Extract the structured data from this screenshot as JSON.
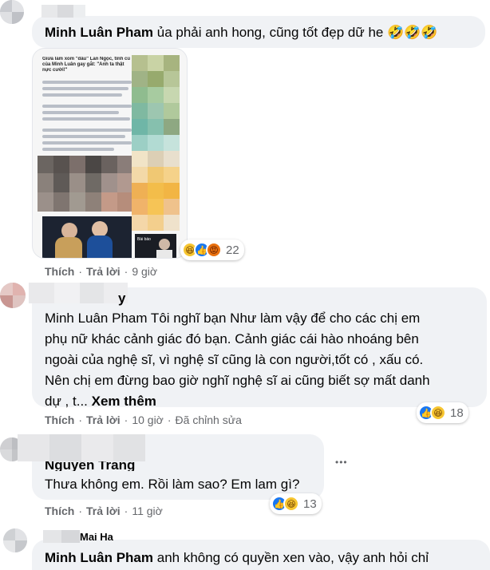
{
  "colors": {
    "bubble": "#f0f2f5",
    "secondary_text": "#65676b",
    "like_blue": "#1877f2",
    "haha_yellow": "#f7c631",
    "angry_orange": "#e9710f"
  },
  "comments": [
    {
      "author": "Minh Luân Pham",
      "text": "ủa phải anh hong, cũng tốt đẹp dữ he 🤣🤣🤣",
      "actions": {
        "like": "Thích",
        "reply": "Trả lời",
        "time": "9 giờ"
      },
      "reactions": {
        "icons": [
          "haha-icon",
          "like-icon",
          "angry-icon"
        ],
        "count": "22"
      },
      "photo": {
        "headline": "Giữa làm xom \"dầu\" Lan Ngọc, tình cũ của Minh Luân gay gắt: \"Anh ta thật nực cười!\"",
        "side_caption": "Bài báo"
      }
    },
    {
      "author_partial": "y",
      "lines": [
        "Minh Luân Pham Tôi nghĩ bạn Như làm vậy để cho các chị em",
        "phụ nữ khác cảnh giác đó bạn. Cảnh giác cái hào nhoáng bên",
        "ngoài của nghệ sĩ, vì nghệ sĩ cũng là con người,tốt có , xấu có.",
        "Nên chị em đừng bao giờ nghĩ nghệ sĩ ai cũng biết sợ mất danh",
        "dự , t..."
      ],
      "see_more": "Xem thêm",
      "actions": {
        "like": "Thích",
        "reply": "Trả lời",
        "time": "10 giờ",
        "edited": "Đã chỉnh sửa"
      },
      "reactions": {
        "icons": [
          "like-icon",
          "haha-icon"
        ],
        "count": "18"
      }
    },
    {
      "author_partial": "Nguyễn Trang",
      "text": "Thưa không em. Rồi làm sao? Em lam gì?",
      "actions": {
        "like": "Thích",
        "reply": "Trả lời",
        "time": "11 giờ"
      },
      "reactions": {
        "icons": [
          "like-icon",
          "haha-icon"
        ],
        "count": "13"
      },
      "more": "•••"
    },
    {
      "author_partial": "Mai Ha",
      "tag": "Minh Luân Pham",
      "text": "anh không có quyền xen vào, vậy anh hỏi chỉ"
    }
  ]
}
